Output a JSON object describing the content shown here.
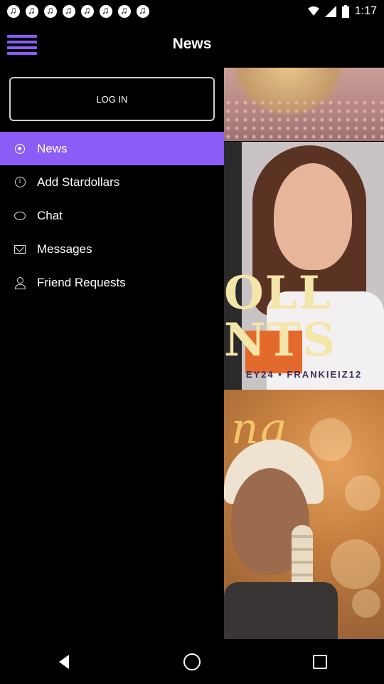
{
  "status_bar": {
    "time": "1:17",
    "notification_icons": [
      "music-note-icon",
      "music-note-icon",
      "music-note-icon",
      "music-note-icon",
      "music-note-icon",
      "music-note-icon",
      "music-note-icon",
      "music-note-icon"
    ]
  },
  "app_bar": {
    "title": "News",
    "menu_icon": "hamburger-menu-icon",
    "accent_color": "#8b5cf6"
  },
  "drawer": {
    "login_label": "LOG IN",
    "items": [
      {
        "label": "News",
        "icon": "gear-icon",
        "active": true
      },
      {
        "label": "Add Stardollars",
        "icon": "info-icon",
        "active": false
      },
      {
        "label": "Chat",
        "icon": "chat-bubble-icon",
        "active": false
      },
      {
        "label": "Messages",
        "icon": "envelope-icon",
        "active": false
      },
      {
        "label": "Friend Requests",
        "icon": "person-icon",
        "active": false
      }
    ]
  },
  "content": {
    "card2_title_text": "OLL\nNTS",
    "card2_credits": "EY24 • FRANKIEIZ12",
    "card3_glyph": "ng"
  },
  "nav_bar": {
    "buttons": [
      "back-icon",
      "home-icon",
      "recents-icon"
    ]
  }
}
